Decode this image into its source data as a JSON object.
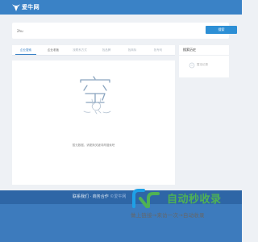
{
  "header": {
    "site_name": "爱牛网"
  },
  "search": {
    "value": "2hu",
    "button_label": "搜索"
  },
  "tabs": [
    {
      "label": "企业搜索",
      "state": "active"
    },
    {
      "label": "企业老板",
      "state": "normal"
    },
    {
      "label": "找联系方式",
      "state": "muted"
    },
    {
      "label": "找品牌",
      "state": "muted"
    },
    {
      "label": "找商标",
      "state": "muted"
    },
    {
      "label": "找专利",
      "state": "muted"
    }
  ],
  "main": {
    "empty_message": "暂无数据，请更换关键词再搜索吧"
  },
  "sidebar": {
    "title": "搜索历史",
    "empty_text": "暂无记录"
  },
  "footer": {
    "line_primary": "联系我们 · 商务合作",
    "line_secondary": "©爱牛网"
  },
  "watermark": {
    "title": "自动秒收录",
    "subtitle": "做上链接→来访一次→自动收录"
  },
  "colors": {
    "brand": "#3a82c6",
    "button": "#2d8fd5",
    "footer": "#3d7bbd",
    "watermark_green": "#4fb254"
  }
}
